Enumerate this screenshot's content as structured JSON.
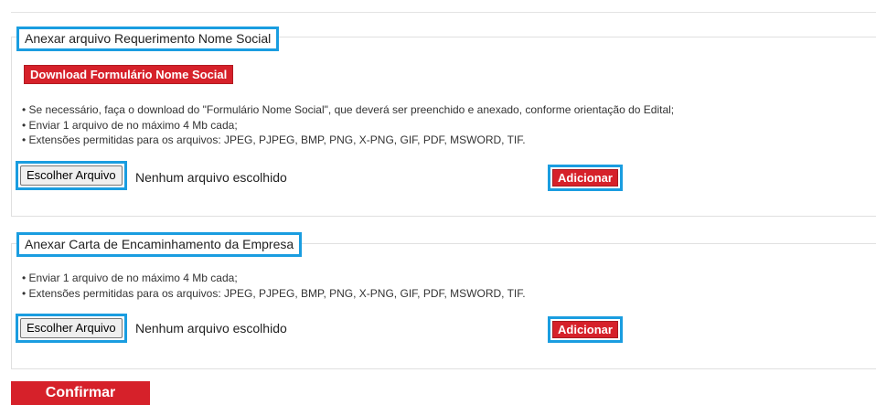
{
  "section1": {
    "legend": "Anexar arquivo Requerimento Nome Social",
    "download_label": "Download Formulário Nome Social",
    "notes": [
      "Se necessário, faça o download do \"Formulário Nome Social\", que deverá ser preenchido e anexado, conforme orientação do Edital;",
      "Enviar 1 arquivo de no máximo 4 Mb cada;",
      "Extensões permitidas para os arquivos: JPEG, PJPEG, BMP, PNG, X-PNG, GIF, PDF, MSWORD, TIF."
    ],
    "choose_file_label": "Escolher Arquivo",
    "file_status": "Nenhum arquivo escolhido",
    "add_label": "Adicionar"
  },
  "section2": {
    "legend": "Anexar Carta de Encaminhamento da Empresa",
    "notes": [
      "Enviar 1 arquivo de no máximo 4 Mb cada;",
      "Extensões permitidas para os arquivos: JPEG, PJPEG, BMP, PNG, X-PNG, GIF, PDF, MSWORD, TIF."
    ],
    "choose_file_label": "Escolher Arquivo",
    "file_status": "Nenhum arquivo escolhido",
    "add_label": "Adicionar"
  },
  "confirm_label": "Confirmar"
}
